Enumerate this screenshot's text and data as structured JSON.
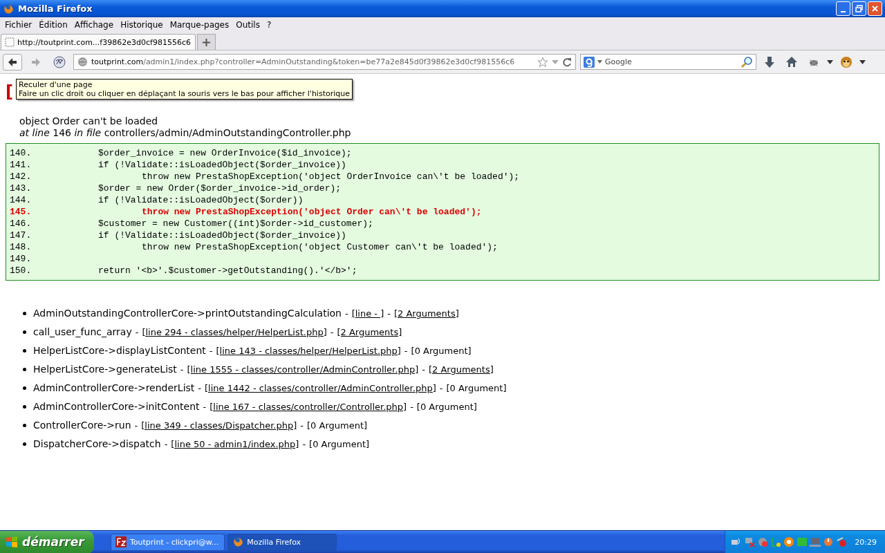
{
  "window": {
    "title": "Mozilla Firefox"
  },
  "menu": [
    "Fichier",
    "Édition",
    "Affichage",
    "Historique",
    "Marque-pages",
    "Outils",
    "?"
  ],
  "tabs": [
    {
      "label": "http://toutprint.com...f39862e3d0cf981556c6",
      "selected": true
    }
  ],
  "address": {
    "domain": "toutprint.com",
    "path": "/admin1/index.php?controller=AdminOutstanding&token=be77a2e845d0f39862e3d0cf981556c6"
  },
  "search": {
    "placeholder": "Google"
  },
  "tooltip": {
    "title": "Reculer d'une page",
    "text": "Faire un clic droit ou cliquer en déplaçant la souris vers le bas pour afficher l'historique"
  },
  "error": {
    "heading": "[",
    "message": "object Order can't be loaded",
    "at_line": "at line",
    "line": "146",
    "in_file": "in file",
    "file": "controllers/admin/AdminOutstandingController.php"
  },
  "code": [
    {
      "number": "140.",
      "text": "$order_invoice = new OrderInvoice($id_invoice);",
      "kind": "statement",
      "highlighted": false
    },
    {
      "number": "141.",
      "text": "if (!Validate::isLoadedObject($order_invoice))",
      "kind": "statement",
      "highlighted": false
    },
    {
      "number": "142.",
      "text": "throw new PrestaShopException('object OrderInvoice can\\'t be loaded');",
      "kind": "nested",
      "highlighted": false
    },
    {
      "number": "143.",
      "text": "$order = new Order($order_invoice->id_order);",
      "kind": "statement",
      "highlighted": false
    },
    {
      "number": "144.",
      "text": "if (!Validate::isLoadedObject($order))",
      "kind": "statement",
      "highlighted": false
    },
    {
      "number": "145.",
      "text": "throw new PrestaShopException('object Order can\\'t be loaded');",
      "kind": "nested",
      "highlighted": true
    },
    {
      "number": "146.",
      "text": "$customer = new Customer((int)$order->id_customer);",
      "kind": "statement",
      "highlighted": false
    },
    {
      "number": "147.",
      "text": "if (!Validate::isLoadedObject($order_invoice))",
      "kind": "statement",
      "highlighted": false
    },
    {
      "number": "148.",
      "text": "throw new PrestaShopException('object Customer can\\'t be loaded');",
      "kind": "nested",
      "highlighted": false
    },
    {
      "number": "149.",
      "kind": "blank",
      "highlighted": false
    },
    {
      "number": "150.",
      "text": "return '<b>'.$customer->getOutstanding().'</b>';",
      "kind": "statement",
      "highlighted": false
    }
  ],
  "trace": [
    {
      "call": "AdminOutstandingControllerCore->printOutstandingCalculation",
      "dash_1": "-",
      "location": "[line - ]",
      "dash_2": "-",
      "arguments": "[2 Arguments]",
      "arguments_linked": true
    },
    {
      "call": "call_user_func_array",
      "dash_1": "-",
      "location": "[line 294 - classes/helper/HelperList.php]",
      "dash_2": "-",
      "arguments": "[2 Arguments]",
      "arguments_linked": true
    },
    {
      "call": "HelperListCore->displayListContent",
      "dash_1": "-",
      "location": "[line 143 - classes/helper/HelperList.php]",
      "dash_2": "-",
      "arguments": "[0 Argument]",
      "arguments_linked": false
    },
    {
      "call": "HelperListCore->generateList",
      "dash_1": "-",
      "location": "[line 1555 - classes/controller/AdminController.php]",
      "dash_2": "-",
      "arguments": "[2 Arguments]",
      "arguments_linked": true
    },
    {
      "call": "AdminControllerCore->renderList",
      "dash_1": "-",
      "location": "[line 1442 - classes/controller/AdminController.php]",
      "dash_2": "-",
      "arguments": "[0 Argument]",
      "arguments_linked": false
    },
    {
      "call": "AdminControllerCore->initContent",
      "dash_1": "-",
      "location": "[line 167 - classes/controller/Controller.php]",
      "dash_2": "-",
      "arguments": "[0 Argument]",
      "arguments_linked": false
    },
    {
      "call": "ControllerCore->run",
      "dash_1": "-",
      "location": "[line 349 - classes/Dispatcher.php]",
      "dash_2": "-",
      "arguments": "[0 Argument]",
      "arguments_linked": false
    },
    {
      "call": "DispatcherCore->dispatch",
      "dash_1": "-",
      "location": "[line 50 - admin1/index.php]",
      "dash_2": "-",
      "arguments": "[0 Argument]",
      "arguments_linked": false
    }
  ],
  "taskbar": {
    "start": "démarrer",
    "tasks": [
      {
        "label": "Toutprint - clickpri@w...",
        "kind": "ftp",
        "selected": false
      },
      {
        "label": "Mozilla Firefox",
        "kind": "browser",
        "selected": true
      }
    ],
    "clock": "20:29"
  }
}
